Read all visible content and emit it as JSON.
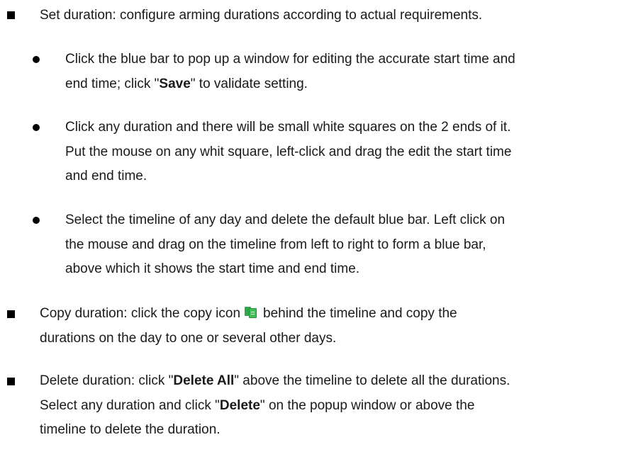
{
  "items": [
    {
      "lines": [
        [
          "Set duration: configure arming durations according to actual requirements."
        ]
      ],
      "subitems": [
        {
          "lines": [
            [
              "Click the blue bar to pop up a window for editing the accurate start time and"
            ],
            [
              "end time; click \"",
              {
                "b": "Save"
              },
              "\" to validate setting."
            ]
          ]
        },
        {
          "lines": [
            [
              "Click any duration and there will be small white squares on the 2 ends of it."
            ],
            [
              "Put the mouse on any whit square, left-click and drag the edit the start time"
            ],
            [
              "and end time."
            ]
          ]
        },
        {
          "lines": [
            [
              "Select the timeline of any day and delete the default blue bar. Left click on"
            ],
            [
              "the mouse and drag on the timeline from left to right to form a blue bar,"
            ],
            [
              "above which it shows the start time and end time."
            ]
          ]
        }
      ]
    },
    {
      "lines": [
        [
          "Copy duration: click the copy icon",
          {
            "icon": "copy-icon"
          },
          "behind the timeline and copy the"
        ],
        [
          "durations on the day to one or several other days."
        ]
      ]
    },
    {
      "lines": [
        [
          "Delete duration: click \"",
          {
            "b": "Delete All"
          },
          "\" above the timeline to delete all the durations."
        ],
        [
          "Select any duration and click \"",
          {
            "b": "Delete"
          },
          "\" on the popup window or above the"
        ],
        [
          "timeline to delete the duration."
        ]
      ]
    }
  ],
  "colors": {
    "text": "#1a1a1a",
    "icon_green": "#3fbf57"
  }
}
